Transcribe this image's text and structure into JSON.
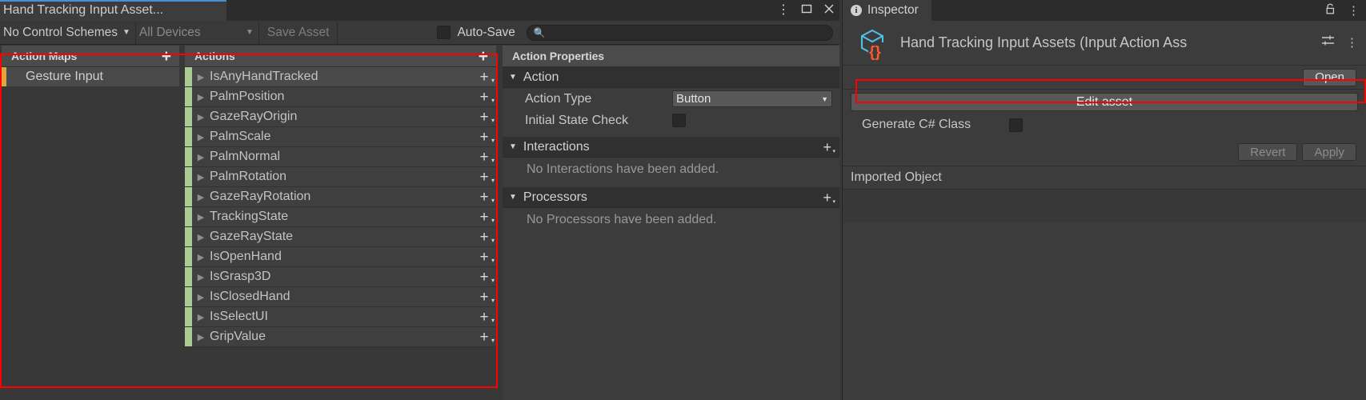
{
  "window": {
    "tab_title": "Hand Tracking Input Asset...",
    "controls": {
      "menu": "kebab-menu",
      "maximize": "maximize",
      "close": "close"
    }
  },
  "toolbar": {
    "control_schemes": "No Control Schemes",
    "devices": "All Devices",
    "save_asset": "Save Asset",
    "auto_save_label": "Auto-Save",
    "auto_save_checked": false,
    "search_value": "",
    "search_placeholder": ""
  },
  "action_maps": {
    "header": "Action Maps",
    "add_label": "+",
    "items": [
      {
        "label": "Gesture Input",
        "selected": true
      }
    ]
  },
  "actions": {
    "header": "Actions",
    "add_label": "+",
    "items": [
      {
        "name": "IsAnyHandTracked",
        "selected": true
      },
      {
        "name": "PalmPosition",
        "selected": false
      },
      {
        "name": "GazeRayOrigin",
        "selected": false
      },
      {
        "name": "PalmScale",
        "selected": false
      },
      {
        "name": "PalmNormal",
        "selected": false
      },
      {
        "name": "PalmRotation",
        "selected": false
      },
      {
        "name": "GazeRayRotation",
        "selected": false
      },
      {
        "name": "TrackingState",
        "selected": false
      },
      {
        "name": "GazeRayState",
        "selected": false
      },
      {
        "name": "IsOpenHand",
        "selected": false
      },
      {
        "name": "IsGrasp3D",
        "selected": false
      },
      {
        "name": "IsClosedHand",
        "selected": false
      },
      {
        "name": "IsSelectUI",
        "selected": false
      },
      {
        "name": "GripValue",
        "selected": false
      }
    ]
  },
  "action_properties": {
    "header": "Action Properties",
    "action_section": "Action",
    "action_type_label": "Action Type",
    "action_type_value": "Button",
    "initial_state_check_label": "Initial State Check",
    "initial_state_check_checked": false,
    "interactions_section": "Interactions",
    "interactions_empty": "No Interactions have been added.",
    "processors_section": "Processors",
    "processors_empty": "No Processors have been added."
  },
  "inspector": {
    "tab_label": "Inspector",
    "lock_icon": "lock-icon",
    "object_title": "Hand Tracking Input Assets (Input Action Ass",
    "open_button": "Open",
    "edit_asset_button": "Edit asset",
    "generate_cs_label": "Generate C# Class",
    "generate_cs_checked": false,
    "revert_button": "Revert",
    "apply_button": "Apply",
    "imported_object": "Imported Object"
  },
  "colors": {
    "accent_blue": "#4a8ed6",
    "selection_orange": "#e0a63b",
    "action_green": "#a9cc92",
    "annotation_red": "#ff0000",
    "asset_icon_cube": "#4ec0e9",
    "asset_icon_braces": "#ff5a2a"
  }
}
